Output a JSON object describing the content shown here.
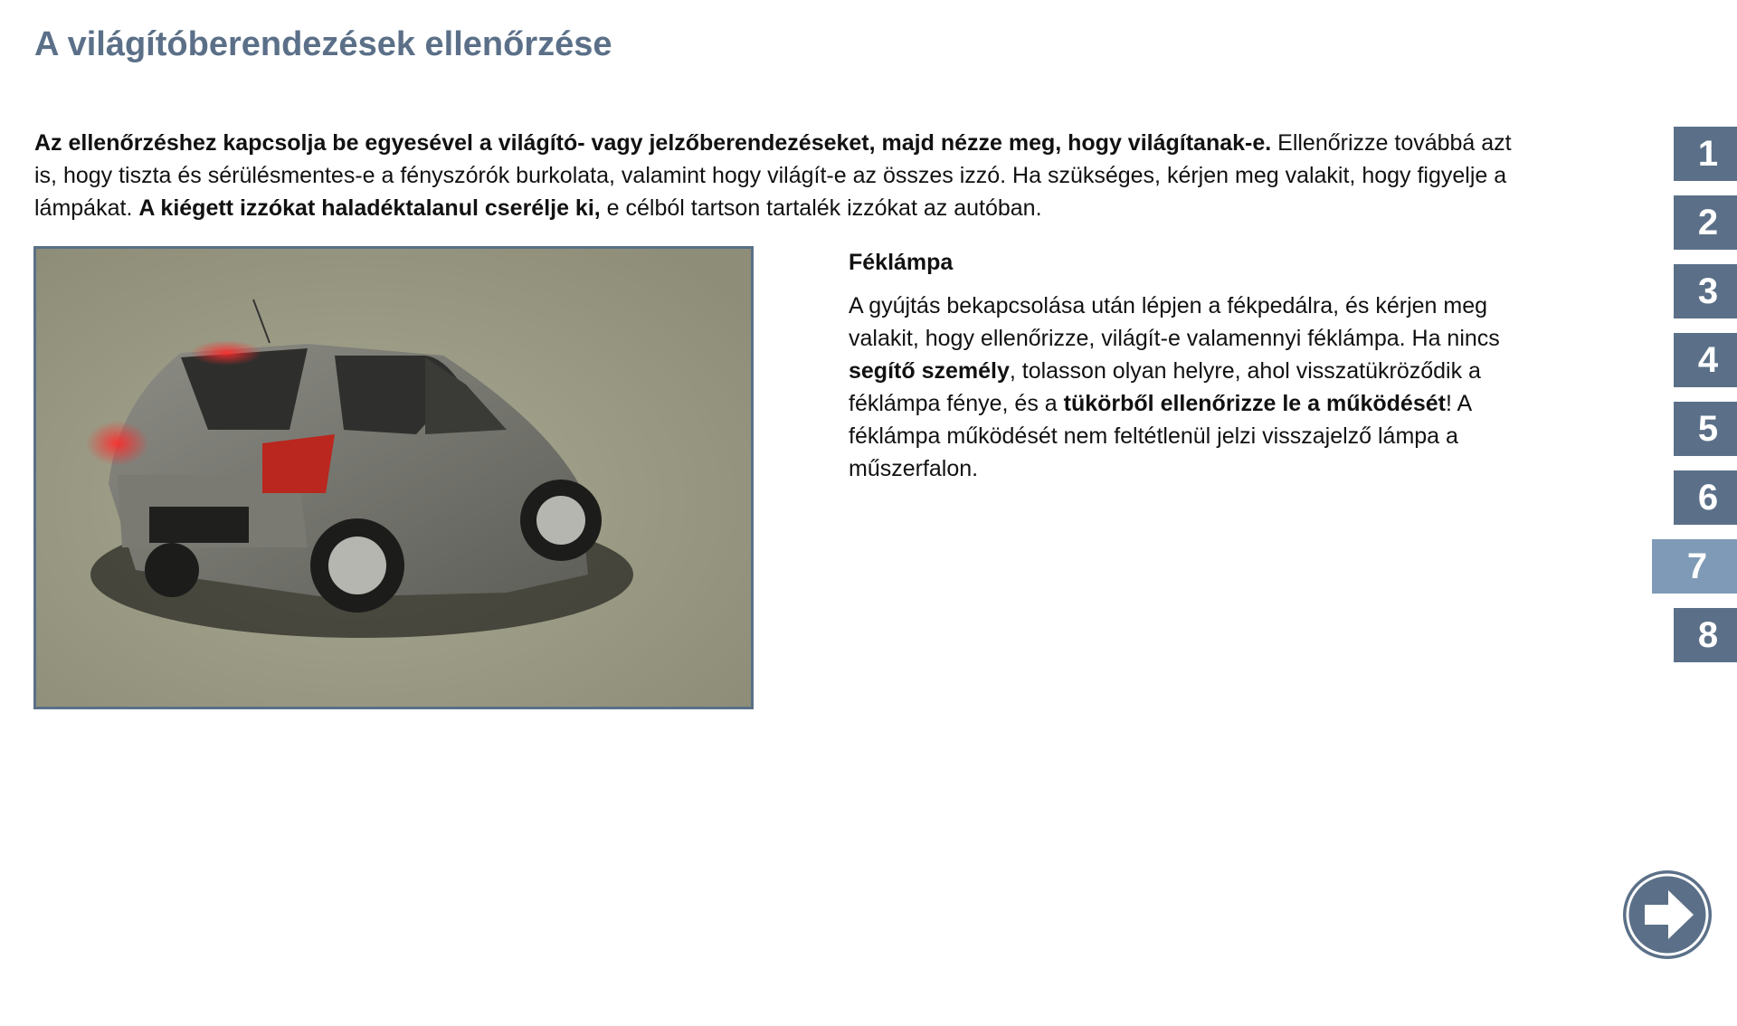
{
  "page": {
    "title": "A világítóberendezések ellenőrzése"
  },
  "intro": {
    "bold1": "Az ellenőrzéshez kapcsolja be egyesével a világító- vagy jelzőberendezéseket, majd nézze meg, hogy világítanak-e.",
    "text1": " Ellenőrizze továbbá azt is, hogy tiszta és sérülésmentes-e a fényszórók burkolata, valamint hogy világít-e az összes izzó. Ha szükséges, kérjen meg valakit, hogy figyelje a lámpákat. ",
    "bold2": "A kiégett izzókat haladéktalanul cserélje ki,",
    "text2": " e célból tartson tartalék izzókat az autóban."
  },
  "section": {
    "heading": "Féklámpa",
    "p1": "A gyújtás bekapcsolása után lépjen a fékpedálra, és kérjen meg valakit, hogy ellenőrizze, világít-e valamennyi féklámpa. Ha nincs ",
    "b1": "segítő személy",
    "p2": ", tolasson olyan helyre, ahol visszatükröződik a féklámpa fénye, és a ",
    "b2": "tükörből ellenőrizze le a működését",
    "p3": "! A féklámpa működését nem feltétlenül jelzi visszajelző lámpa a műszerfalon."
  },
  "steps": [
    {
      "label": "1"
    },
    {
      "label": "2"
    },
    {
      "label": "3"
    },
    {
      "label": "4"
    },
    {
      "label": "5"
    },
    {
      "label": "6"
    },
    {
      "label": "7",
      "active": true
    },
    {
      "label": "8"
    }
  ],
  "next_button": {
    "icon": "arrow-right-icon"
  },
  "colors": {
    "accent": "#5b7088",
    "active_step": "#7f9ab6",
    "photo_background": "#9e9e88",
    "brake_light": "#e0202a"
  }
}
